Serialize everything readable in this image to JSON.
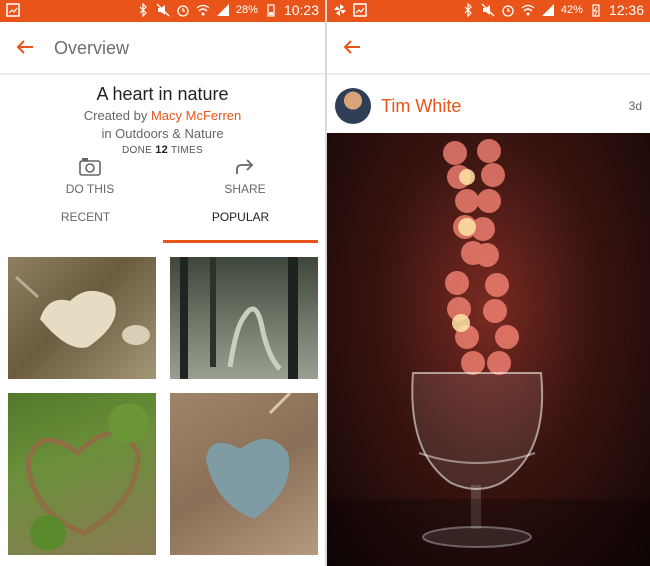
{
  "left": {
    "status": {
      "battery_pct": "28%",
      "time": "10:23"
    },
    "appbar": {
      "title": "Overview"
    },
    "project": {
      "title": "A heart in nature",
      "created_by_prefix": "Created by",
      "author": "Macy McFerren",
      "category": "in Outdoors & Nature",
      "done_prefix": "DONE",
      "done_count": "12",
      "done_suffix": "TIMES"
    },
    "actions": {
      "do_this": "DO THIS",
      "share": "SHARE"
    },
    "tabs": {
      "recent": "RECENT",
      "popular": "POPULAR",
      "active": "popular"
    }
  },
  "right": {
    "status": {
      "battery_pct": "42%",
      "time": "12:36"
    },
    "post": {
      "user": "Tim White",
      "age": "3d"
    }
  },
  "colors": {
    "accent": "#e8541a"
  },
  "icons": [
    "back-arrow-icon",
    "camera-icon",
    "share-arrow-icon",
    "bluetooth-icon",
    "mute-icon",
    "alarm-icon",
    "wifi-icon",
    "signal-icon",
    "battery-icon",
    "gallery-notification-icon",
    "pinwheel-icon"
  ]
}
